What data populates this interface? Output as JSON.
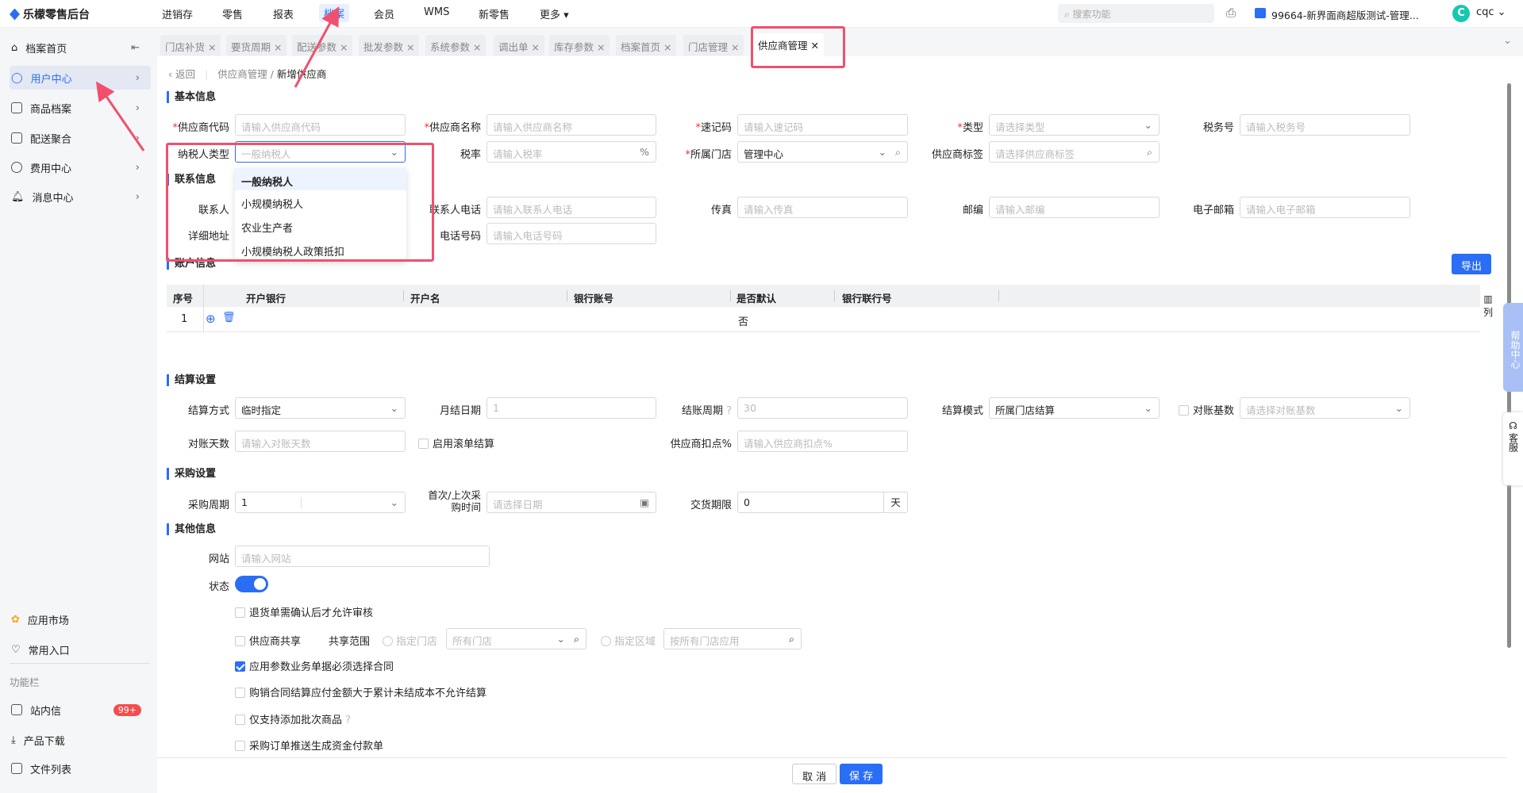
{
  "app": {
    "title": "乐檬零售后台"
  },
  "nav": [
    "进销存",
    "零售",
    "报表",
    "档案",
    "会员",
    "WMS",
    "新零售",
    "更多"
  ],
  "header": {
    "search_placeholder": "搜索功能",
    "store": "99664-新界面商超版测试-管理...",
    "user": "cqc",
    "avatar_letter": "C"
  },
  "sidebar": {
    "items": [
      "档案首页",
      "用户中心",
      "商品档案",
      "配送聚合",
      "费用中心",
      "消息中心"
    ],
    "bottom": [
      "应用市场",
      "常用入口"
    ],
    "section": "功能栏",
    "tools": [
      "站内信",
      "产品下载",
      "文件列表"
    ],
    "badge": "99+"
  },
  "tabs": [
    "门店补货",
    "要货周期",
    "配送参数",
    "批发参数",
    "系统参数",
    "调出单",
    "库存参数",
    "档案首页",
    "门店管理",
    "供应商管理"
  ],
  "breadcrumb": {
    "back": "返回",
    "parent": "供应商管理",
    "current": "新增供应商"
  },
  "sections": {
    "basic": "基本信息",
    "contact": "联系信息",
    "account": "账户信息",
    "settle": "结算设置",
    "purchase": "采购设置",
    "other": "其他信息"
  },
  "basic": {
    "code": {
      "label": "供应商代码",
      "placeholder": "请输入供应商代码"
    },
    "name": {
      "label": "供应商名称",
      "placeholder": "请输入供应商名称"
    },
    "quick": {
      "label": "速记码",
      "placeholder": "请输入速记码"
    },
    "type": {
      "label": "类型",
      "placeholder": "请选择类型"
    },
    "taxno": {
      "label": "税务号",
      "placeholder": "请输入税务号"
    },
    "taxpayer": {
      "label": "纳税人类型",
      "placeholder": "一般纳税人"
    },
    "rate": {
      "label": "税率",
      "placeholder": "请输入税率",
      "suffix": "%"
    },
    "store": {
      "label": "所属门店",
      "value": "管理中心"
    },
    "tag": {
      "label": "供应商标签",
      "placeholder": "请选择供应商标签"
    }
  },
  "taxpayer_options": [
    "一般纳税人",
    "小规模纳税人",
    "农业生产者",
    "小规模纳税人政策抵扣"
  ],
  "contact": {
    "person": {
      "label": "联系人"
    },
    "phone": {
      "label": "联系人电话",
      "placeholder": "请输入联系人电话"
    },
    "fax": {
      "label": "传真",
      "placeholder": "请输入传真"
    },
    "zip": {
      "label": "邮编",
      "placeholder": "请输入邮编"
    },
    "email": {
      "label": "电子邮箱",
      "placeholder": "请输入电子邮箱"
    },
    "address": {
      "label": "详细地址"
    },
    "tel": {
      "label": "电话号码",
      "placeholder": "请输入电话号码"
    }
  },
  "account": {
    "export": "导出",
    "columns": [
      "序号",
      "开户银行",
      "开户名",
      "银行账号",
      "是否默认",
      "银行联行号"
    ],
    "rows": [
      {
        "no": "1",
        "default": "否"
      }
    ],
    "col_setting": "列"
  },
  "settle": {
    "method": {
      "label": "结算方式",
      "value": "临时指定"
    },
    "monthday": {
      "label": "月结日期",
      "value": "1"
    },
    "period": {
      "label": "结账周期",
      "value": "30"
    },
    "mode": {
      "label": "结算模式",
      "value": "所属门店结算"
    },
    "base": {
      "label": "对账基数",
      "placeholder": "请选择对账基数"
    },
    "days": {
      "label": "对账天数",
      "placeholder": "请输入对账天数"
    },
    "rolling": {
      "label": "启用滚单结算"
    },
    "discount": {
      "label": "供应商扣点%",
      "placeholder": "请输入供应商扣点%"
    }
  },
  "purchase": {
    "cycle": {
      "label": "采购周期",
      "value": "1"
    },
    "time": {
      "label1": "首次/上次采",
      "label2": "购时间",
      "placeholder": "请选择日期"
    },
    "delivery": {
      "label": "交货期限",
      "value": "0",
      "suffix": "天"
    }
  },
  "other": {
    "website": {
      "label": "网站",
      "placeholder": "请输入网站"
    },
    "status": {
      "label": "状态",
      "on": true
    },
    "return_confirm": "退货单需确认后才允许审核",
    "share": "供应商共享",
    "share_scope": "共享范围",
    "scope_store": "指定门店",
    "store_placeholder": "所有门店",
    "scope_region": "指定区域",
    "region_placeholder": "按所有门店应用",
    "contract_required": "应用参数业务单据必须选择合同",
    "contract_amount": "购销合同结算应付金额大于累计未结成本不允许结算",
    "batch_only": "仅支持添加批次商品",
    "push_payment": "采购订单推送生成资金付款单"
  },
  "footer": {
    "cancel": "取 消",
    "save": "保 存"
  },
  "float": {
    "help": "帮助中心",
    "service": "客服"
  },
  "colors": {
    "accent": "#2a6ef5",
    "highlight": "#f0506e"
  }
}
